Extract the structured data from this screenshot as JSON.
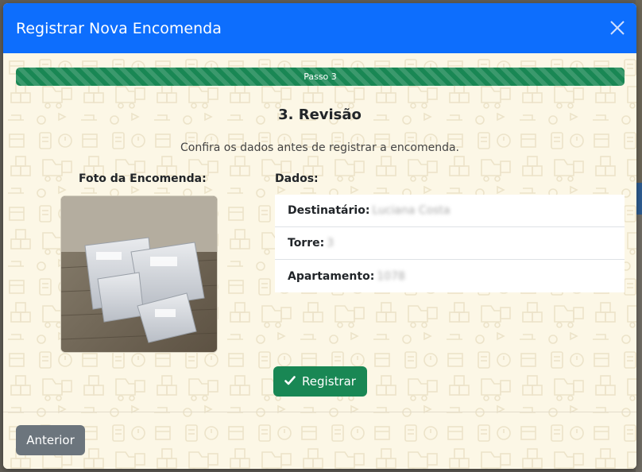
{
  "modal": {
    "title": "Registrar Nova Encomenda",
    "close_icon": "close-icon"
  },
  "progress": {
    "label": "Passo 3",
    "percent": 100,
    "color": "#198754"
  },
  "step": {
    "title": "3. Revisão",
    "subtitle": "Confira os dados antes de registrar a encomenda."
  },
  "photo": {
    "label": "Foto da Encomenda:"
  },
  "details": {
    "label": "Dados:",
    "rows": [
      {
        "key": "Destinatário:",
        "value": "Luciana Costa"
      },
      {
        "key": "Torre:",
        "value": "3"
      },
      {
        "key": "Apartamento:",
        "value": "1078"
      }
    ]
  },
  "actions": {
    "register_label": "Registrar",
    "register_icon": "check-icon",
    "previous_label": "Anterior"
  },
  "colors": {
    "header": "#0d6efd",
    "success": "#198754",
    "secondary": "#6c757d",
    "body_bg": "#fdf8ea"
  }
}
